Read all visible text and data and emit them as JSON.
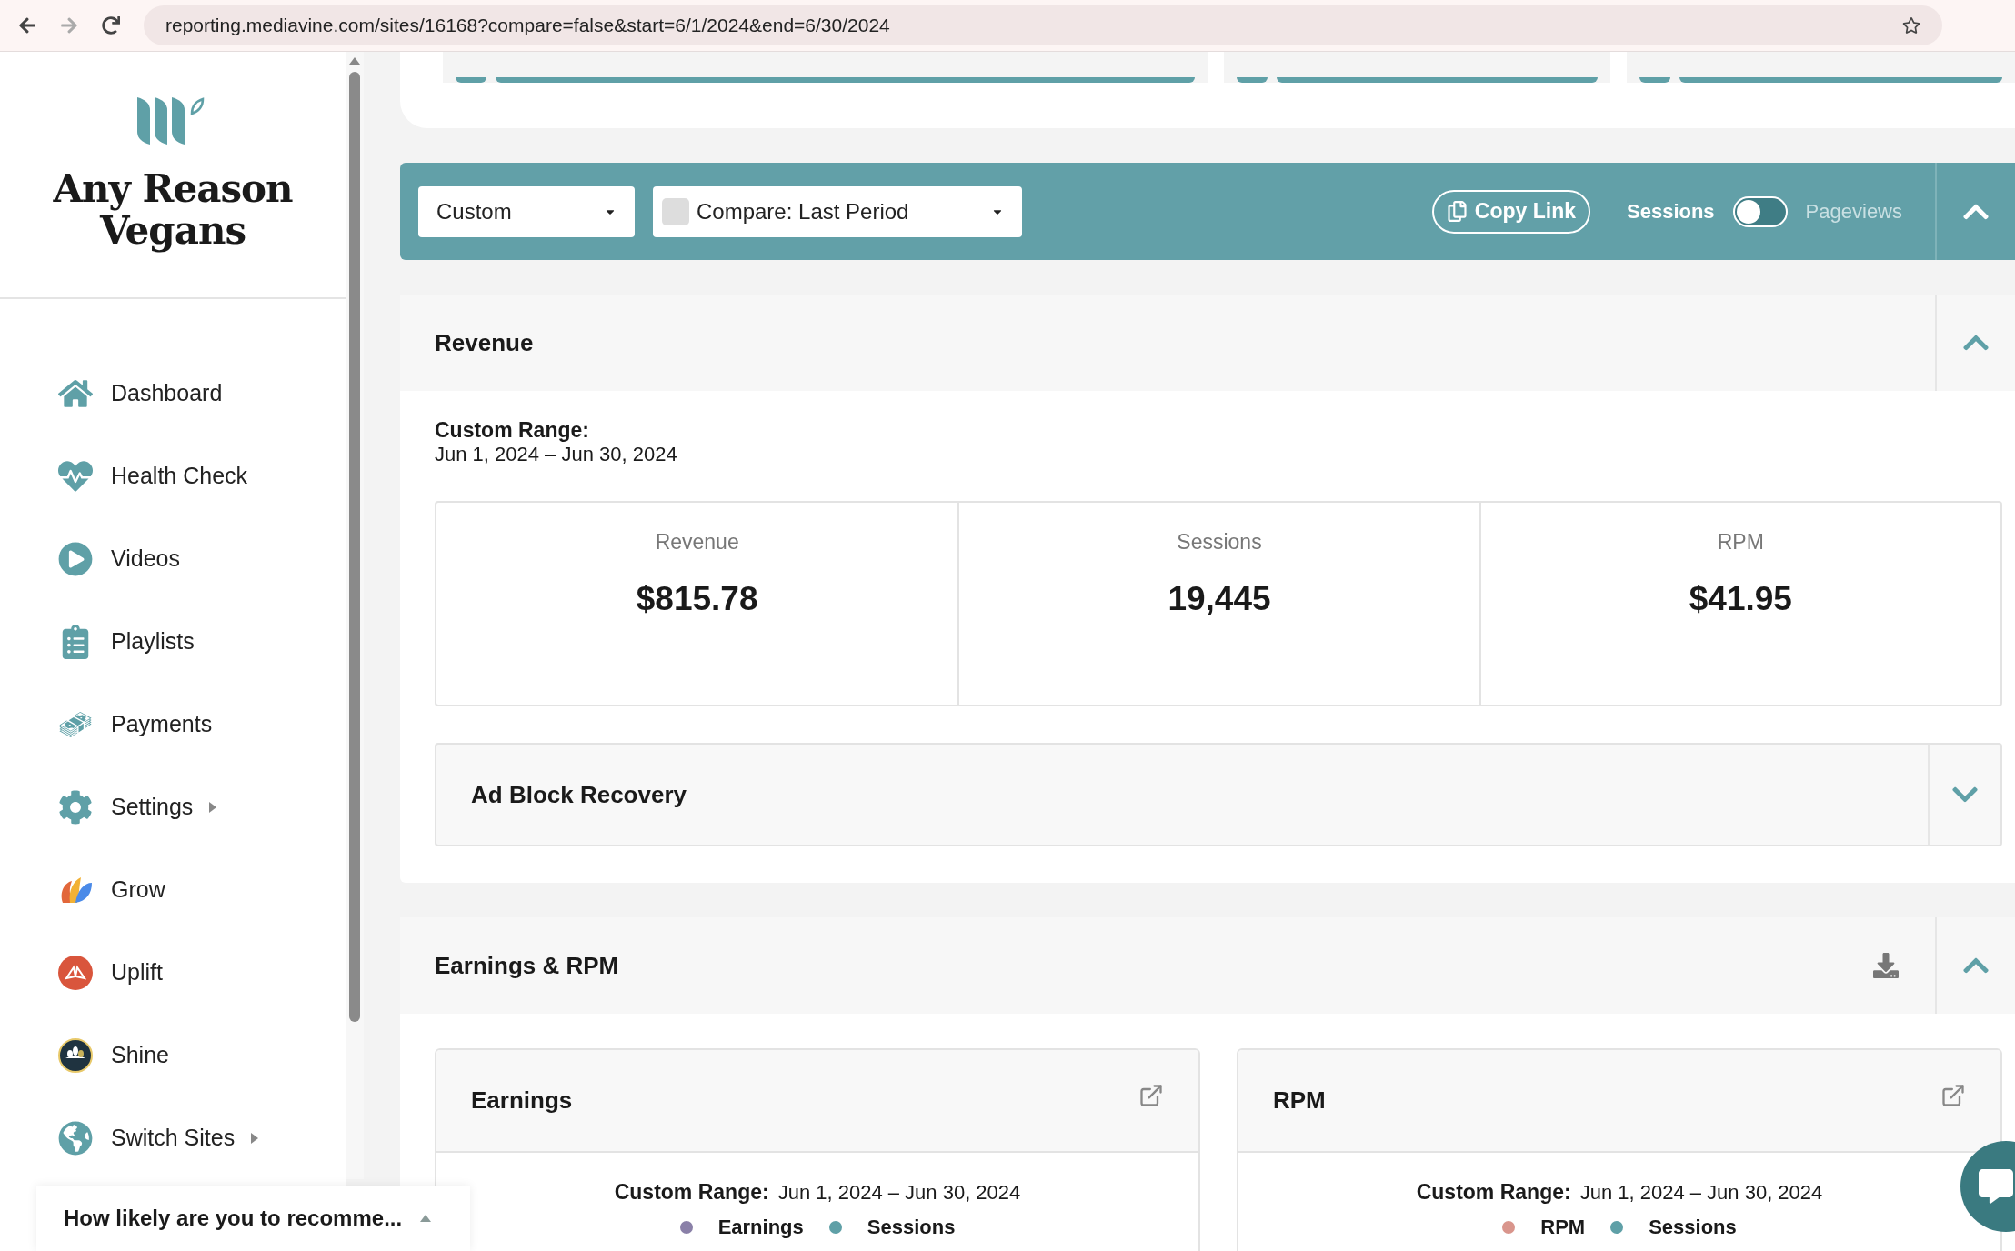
{
  "browser": {
    "url": "reporting.mediavine.com/sites/16168?compare=false&start=6/1/2024&end=6/30/2024"
  },
  "sidebar": {
    "site_name": "Any Reason Vegans",
    "items": [
      {
        "label": "Dashboard",
        "submenu": false
      },
      {
        "label": "Health Check",
        "submenu": false
      },
      {
        "label": "Videos",
        "submenu": false
      },
      {
        "label": "Playlists",
        "submenu": false
      },
      {
        "label": "Payments",
        "submenu": false
      },
      {
        "label": "Settings",
        "submenu": true
      },
      {
        "label": "Grow",
        "submenu": false
      },
      {
        "label": "Uplift",
        "submenu": false
      },
      {
        "label": "Shine",
        "submenu": false
      },
      {
        "label": "Switch Sites",
        "submenu": true
      }
    ]
  },
  "toolbar": {
    "range_select": "Custom",
    "compare_select": "Compare: Last Period",
    "compare_checked": false,
    "copy_link": "Copy Link",
    "toggle": {
      "left": "Sessions",
      "right": "Pageviews",
      "on": false
    },
    "expanded": true
  },
  "revenue": {
    "title": "Revenue",
    "expanded": true,
    "range_label": "Custom Range:",
    "range": "Jun 1, 2024 – Jun 30, 2024",
    "stats": [
      {
        "label": "Revenue",
        "value": "$815.78"
      },
      {
        "label": "Sessions",
        "value": "19,445"
      },
      {
        "label": "RPM",
        "value": "$41.95"
      }
    ],
    "ad_block": {
      "title": "Ad Block Recovery",
      "expanded": false
    }
  },
  "earnings_rpm": {
    "title": "Earnings & RPM",
    "expanded": true,
    "cards": [
      {
        "title": "Earnings",
        "range_label": "Custom Range:",
        "range": "Jun 1, 2024 – Jun 30, 2024",
        "legend": [
          {
            "label": "Earnings",
            "color": "#8a80a8"
          },
          {
            "label": "Sessions",
            "color": "#5fa0a7"
          }
        ]
      },
      {
        "title": "RPM",
        "range_label": "Custom Range:",
        "range": "Jun 1, 2024 – Jun 30, 2024",
        "legend": [
          {
            "label": "RPM",
            "color": "#d9958c"
          },
          {
            "label": "Sessions",
            "color": "#5fa0a7"
          }
        ]
      }
    ]
  },
  "survey": {
    "text": "How likely are you to recomme...",
    "expanded": false
  }
}
